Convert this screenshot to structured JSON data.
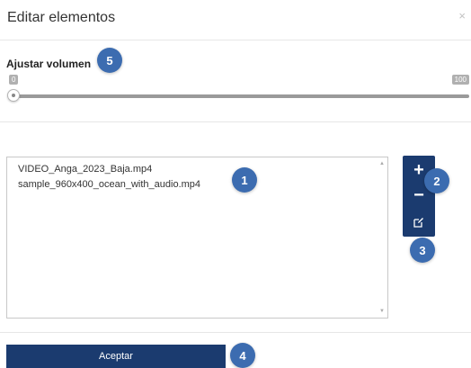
{
  "dialog": {
    "title": "Editar elementos",
    "close_label": "×"
  },
  "volume": {
    "label": "Ajustar volumen",
    "min_label": "0",
    "max_label": "100",
    "value": 0
  },
  "file_list": {
    "items": [
      "VIDEO_Anga_2023_Baja.mp4",
      "sample_960x400_ocean_with_audio.mp4"
    ]
  },
  "toolbar": {
    "add_label": "+",
    "remove_label": "−",
    "edit_icon": "edit-icon"
  },
  "footer": {
    "accept_label": "Aceptar"
  },
  "callouts": [
    "1",
    "2",
    "3",
    "4",
    "5"
  ],
  "colors": {
    "primary": "#1b3b6f",
    "callout": "#3c6cb0"
  }
}
